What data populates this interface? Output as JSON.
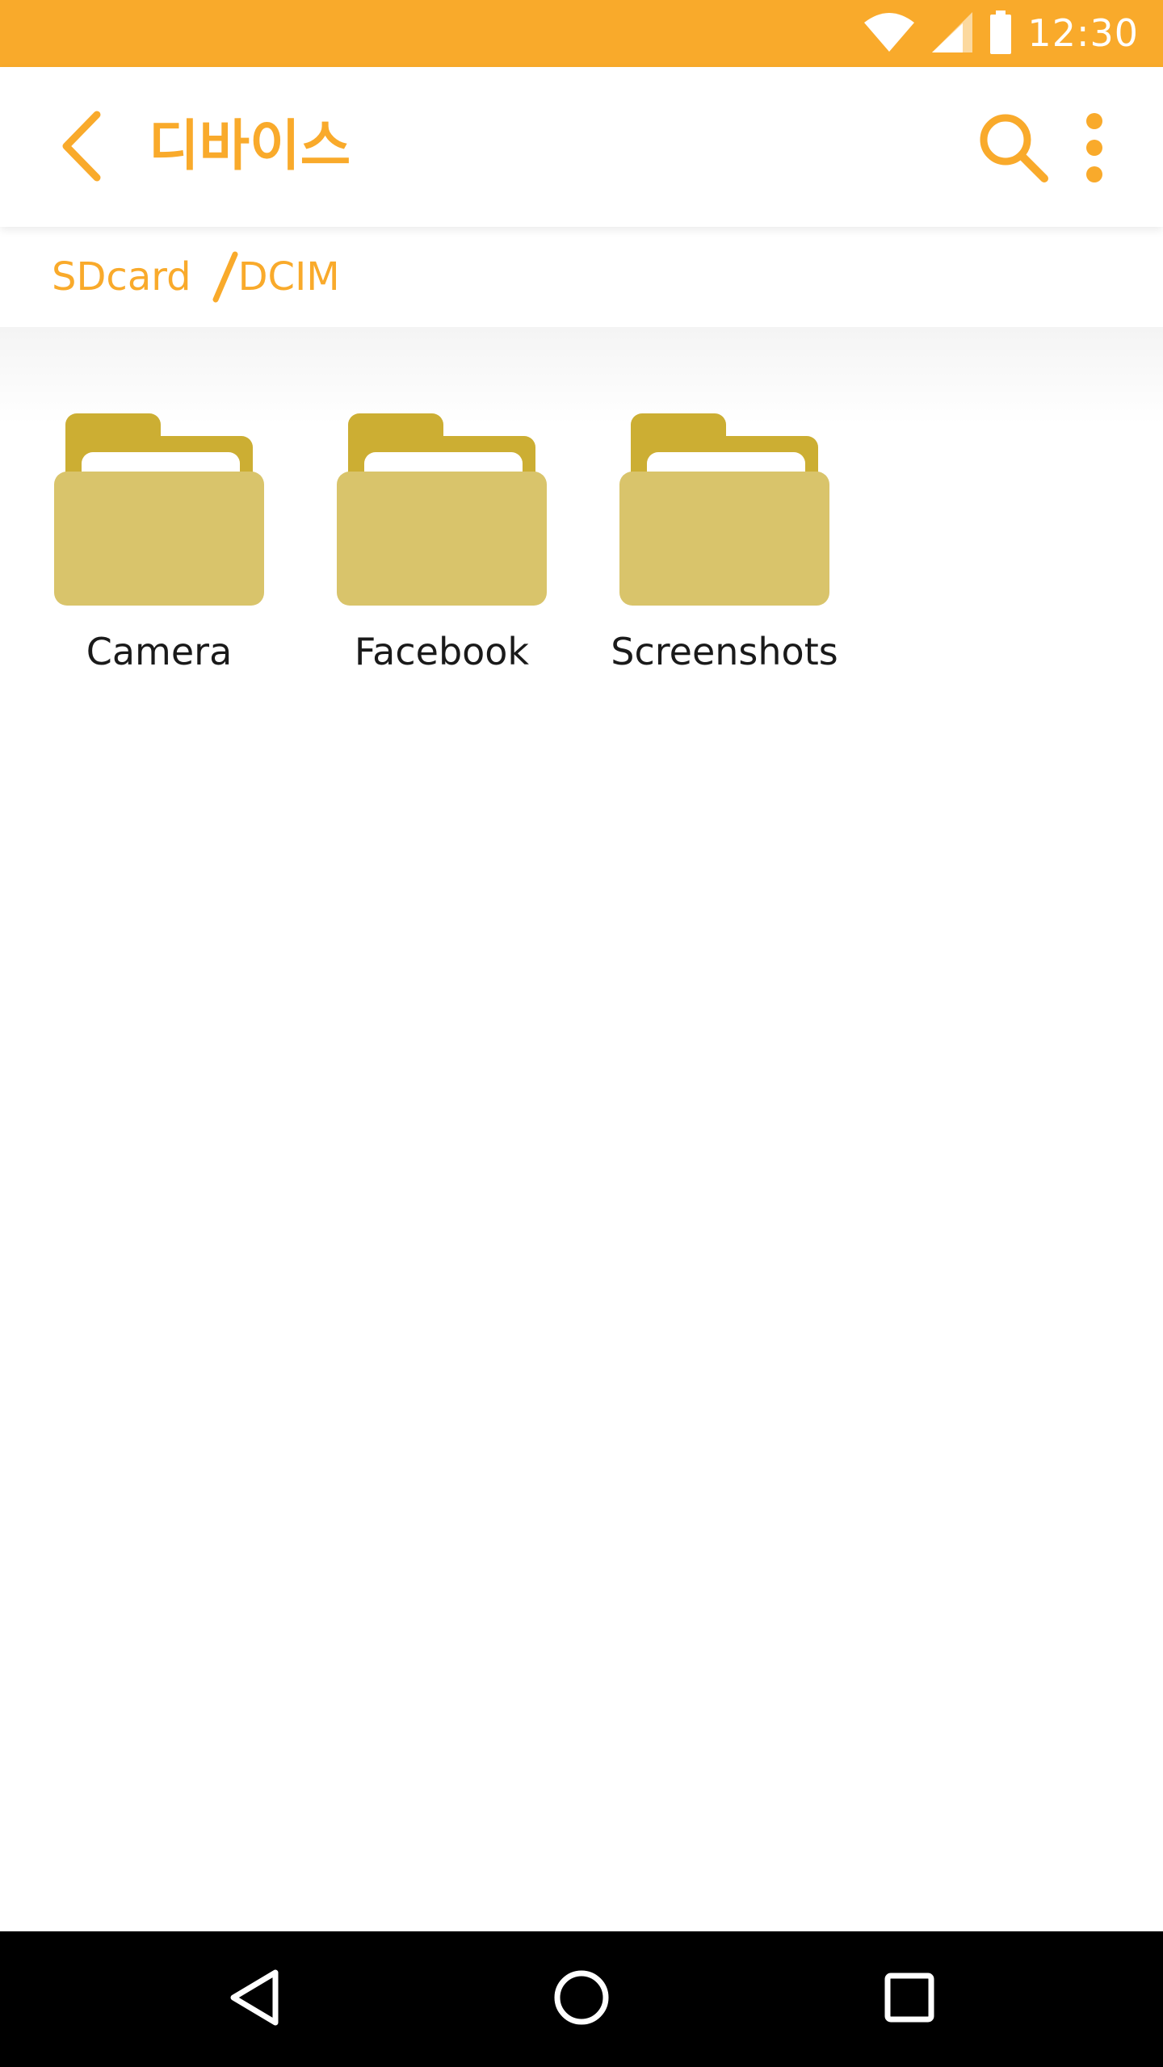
{
  "status_bar": {
    "time": "12:30",
    "icons": [
      "wifi-icon",
      "cell-signal-icon",
      "battery-icon"
    ],
    "background_color": "#F9AA2B"
  },
  "toolbar": {
    "title": "디바이스",
    "back_icon": "chevron-left-icon",
    "search_icon": "search-icon",
    "more_icon": "more-vert-icon",
    "accent_color": "#F9AA2B"
  },
  "breadcrumb": {
    "items": [
      {
        "label": "SDcard"
      },
      {
        "label": "DCIM"
      }
    ]
  },
  "folders": [
    {
      "label": "Camera",
      "icon": "folder-icon"
    },
    {
      "label": "Facebook",
      "icon": "folder-icon"
    },
    {
      "label": "Screenshots",
      "icon": "folder-icon"
    }
  ],
  "colors": {
    "folder_back": "#CCAE33",
    "folder_front": "#D9C46B",
    "folder_paper": "#ffffff"
  },
  "nav_bar": {
    "buttons": [
      "back-triangle-icon",
      "home-circle-icon",
      "recents-square-icon"
    ]
  }
}
